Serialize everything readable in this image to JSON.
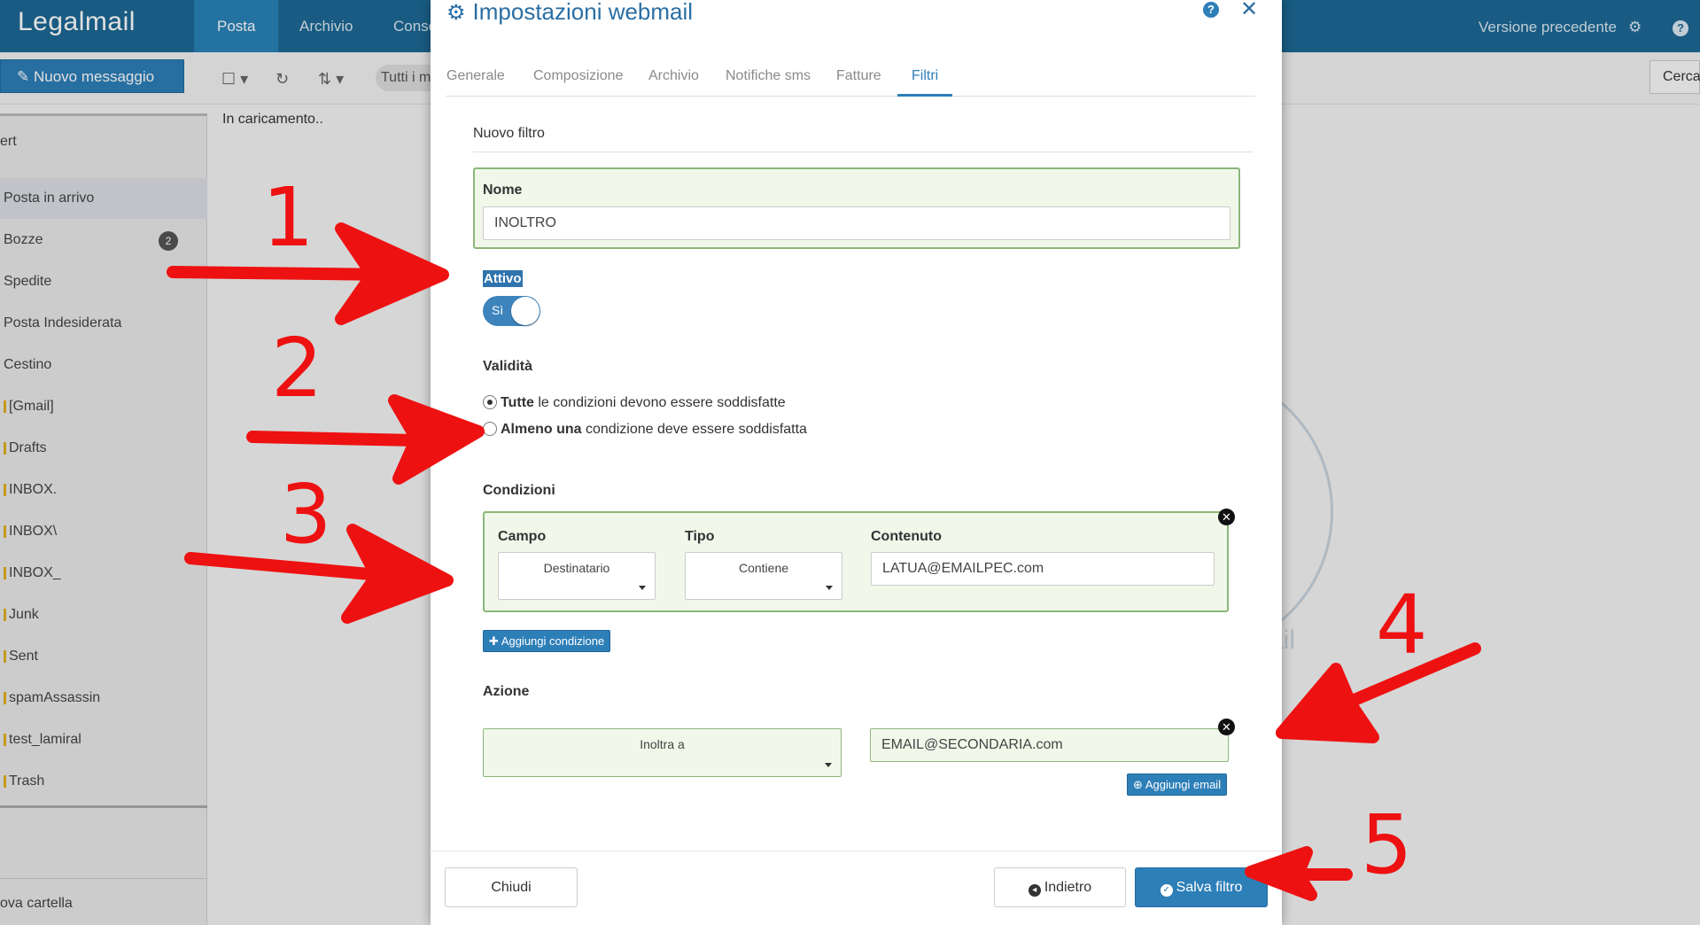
{
  "app": {
    "logo": "Legalmail",
    "nav": [
      "Posta",
      "Archivio",
      "Conse"
    ],
    "top_right": {
      "previous_version": "Versione precedente"
    }
  },
  "toolbar": {
    "compose_label": "Nuovo messaggio",
    "filter_pill": "Tutti i m",
    "search_label": "Cerca"
  },
  "sidebar": {
    "account": "ert",
    "folders": [
      {
        "label": "Posta in arrivo"
      },
      {
        "label": "Bozze",
        "badge": "2"
      },
      {
        "label": "Spedite"
      },
      {
        "label": "Posta Indesiderata"
      },
      {
        "label": "Cestino"
      },
      {
        "label": "[Gmail]"
      },
      {
        "label": "Drafts"
      },
      {
        "label": "INBOX."
      },
      {
        "label": "INBOX\\"
      },
      {
        "label": "INBOX_"
      },
      {
        "label": "Junk"
      },
      {
        "label": "Sent"
      },
      {
        "label": "spamAssassin"
      },
      {
        "label": "test_lamiral"
      },
      {
        "label": "Trash"
      }
    ],
    "new_folder": "ova cartella"
  },
  "main": {
    "loading": "In caricamento..",
    "bg_text": "ail"
  },
  "modal": {
    "title": "Impostazioni webmail",
    "tabs": [
      "Generale",
      "Composizione",
      "Archivio",
      "Notifiche sms",
      "Fatture",
      "Filtri"
    ],
    "active_tab": "Filtri",
    "section_title": "Nuovo filtro",
    "name_label": "Nome",
    "name_value": "INOLTRO",
    "active_label": "Attivo",
    "toggle_text": "Sì",
    "validity_label": "Validità",
    "validity_options": [
      {
        "bold": "Tutte",
        "rest": " le condizioni devono essere soddisfatte",
        "checked": true
      },
      {
        "bold": "Almeno una",
        "rest": " condizione deve essere soddisfatta",
        "checked": false
      }
    ],
    "conditions_label": "Condizioni",
    "condition": {
      "field_label": "Campo",
      "field_value": "Destinatario",
      "type_label": "Tipo",
      "type_value": "Contiene",
      "content_label": "Contenuto",
      "content_value": "LATUA@EMAILPEC.com"
    },
    "add_condition": "Aggiungi condizione",
    "action_label": "Azione",
    "action_value": "Inoltra a",
    "action_email": "EMAIL@SECONDARIA.com",
    "add_email": "Aggiungi email",
    "footer": {
      "close": "Chiudi",
      "back": "Indietro",
      "save": "Salva filtro"
    }
  },
  "annotations": [
    "1",
    "2",
    "3",
    "4",
    "5"
  ],
  "colors": {
    "accent": "#2d7fb8",
    "header": "#1d6895",
    "annotation": "#ee1111",
    "box_bg": "#f1f8ea",
    "box_border": "#8cb67a"
  }
}
